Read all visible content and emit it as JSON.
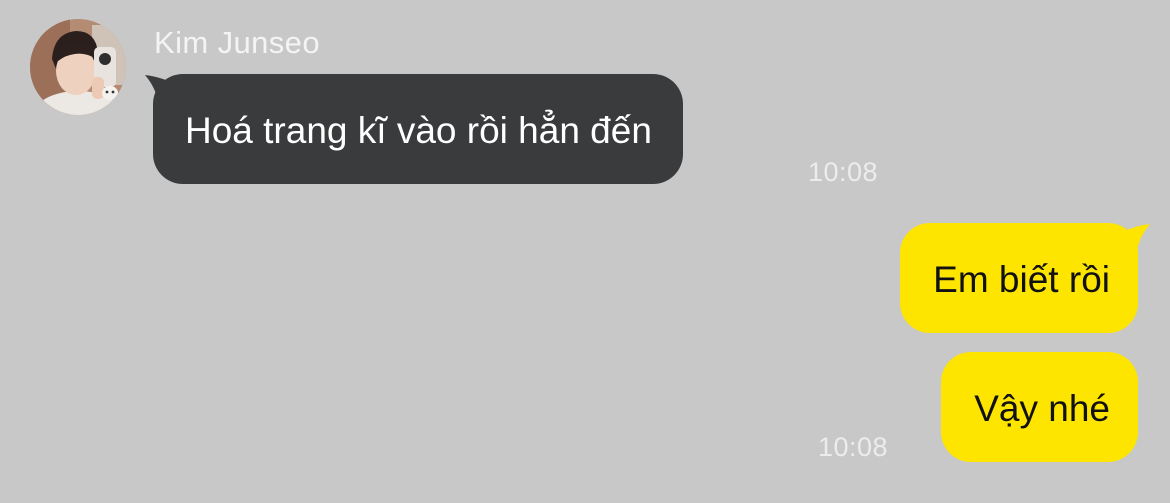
{
  "conversation": {
    "incoming": {
      "sender_name": "Kim Junseo",
      "avatar_icon": "user-photo-avatar",
      "message": "Hoá trang kĩ vào rồi hẳn đến",
      "time": "10:08",
      "bubble_color": "#3a3b3d",
      "text_color": "#ffffff"
    },
    "outgoing": [
      {
        "message": "Em biết rồi"
      },
      {
        "message": "Vậy nhé",
        "time": "10:08"
      }
    ],
    "outgoing_bubble_color": "#fee500",
    "background_color": "#c8c8c8"
  }
}
